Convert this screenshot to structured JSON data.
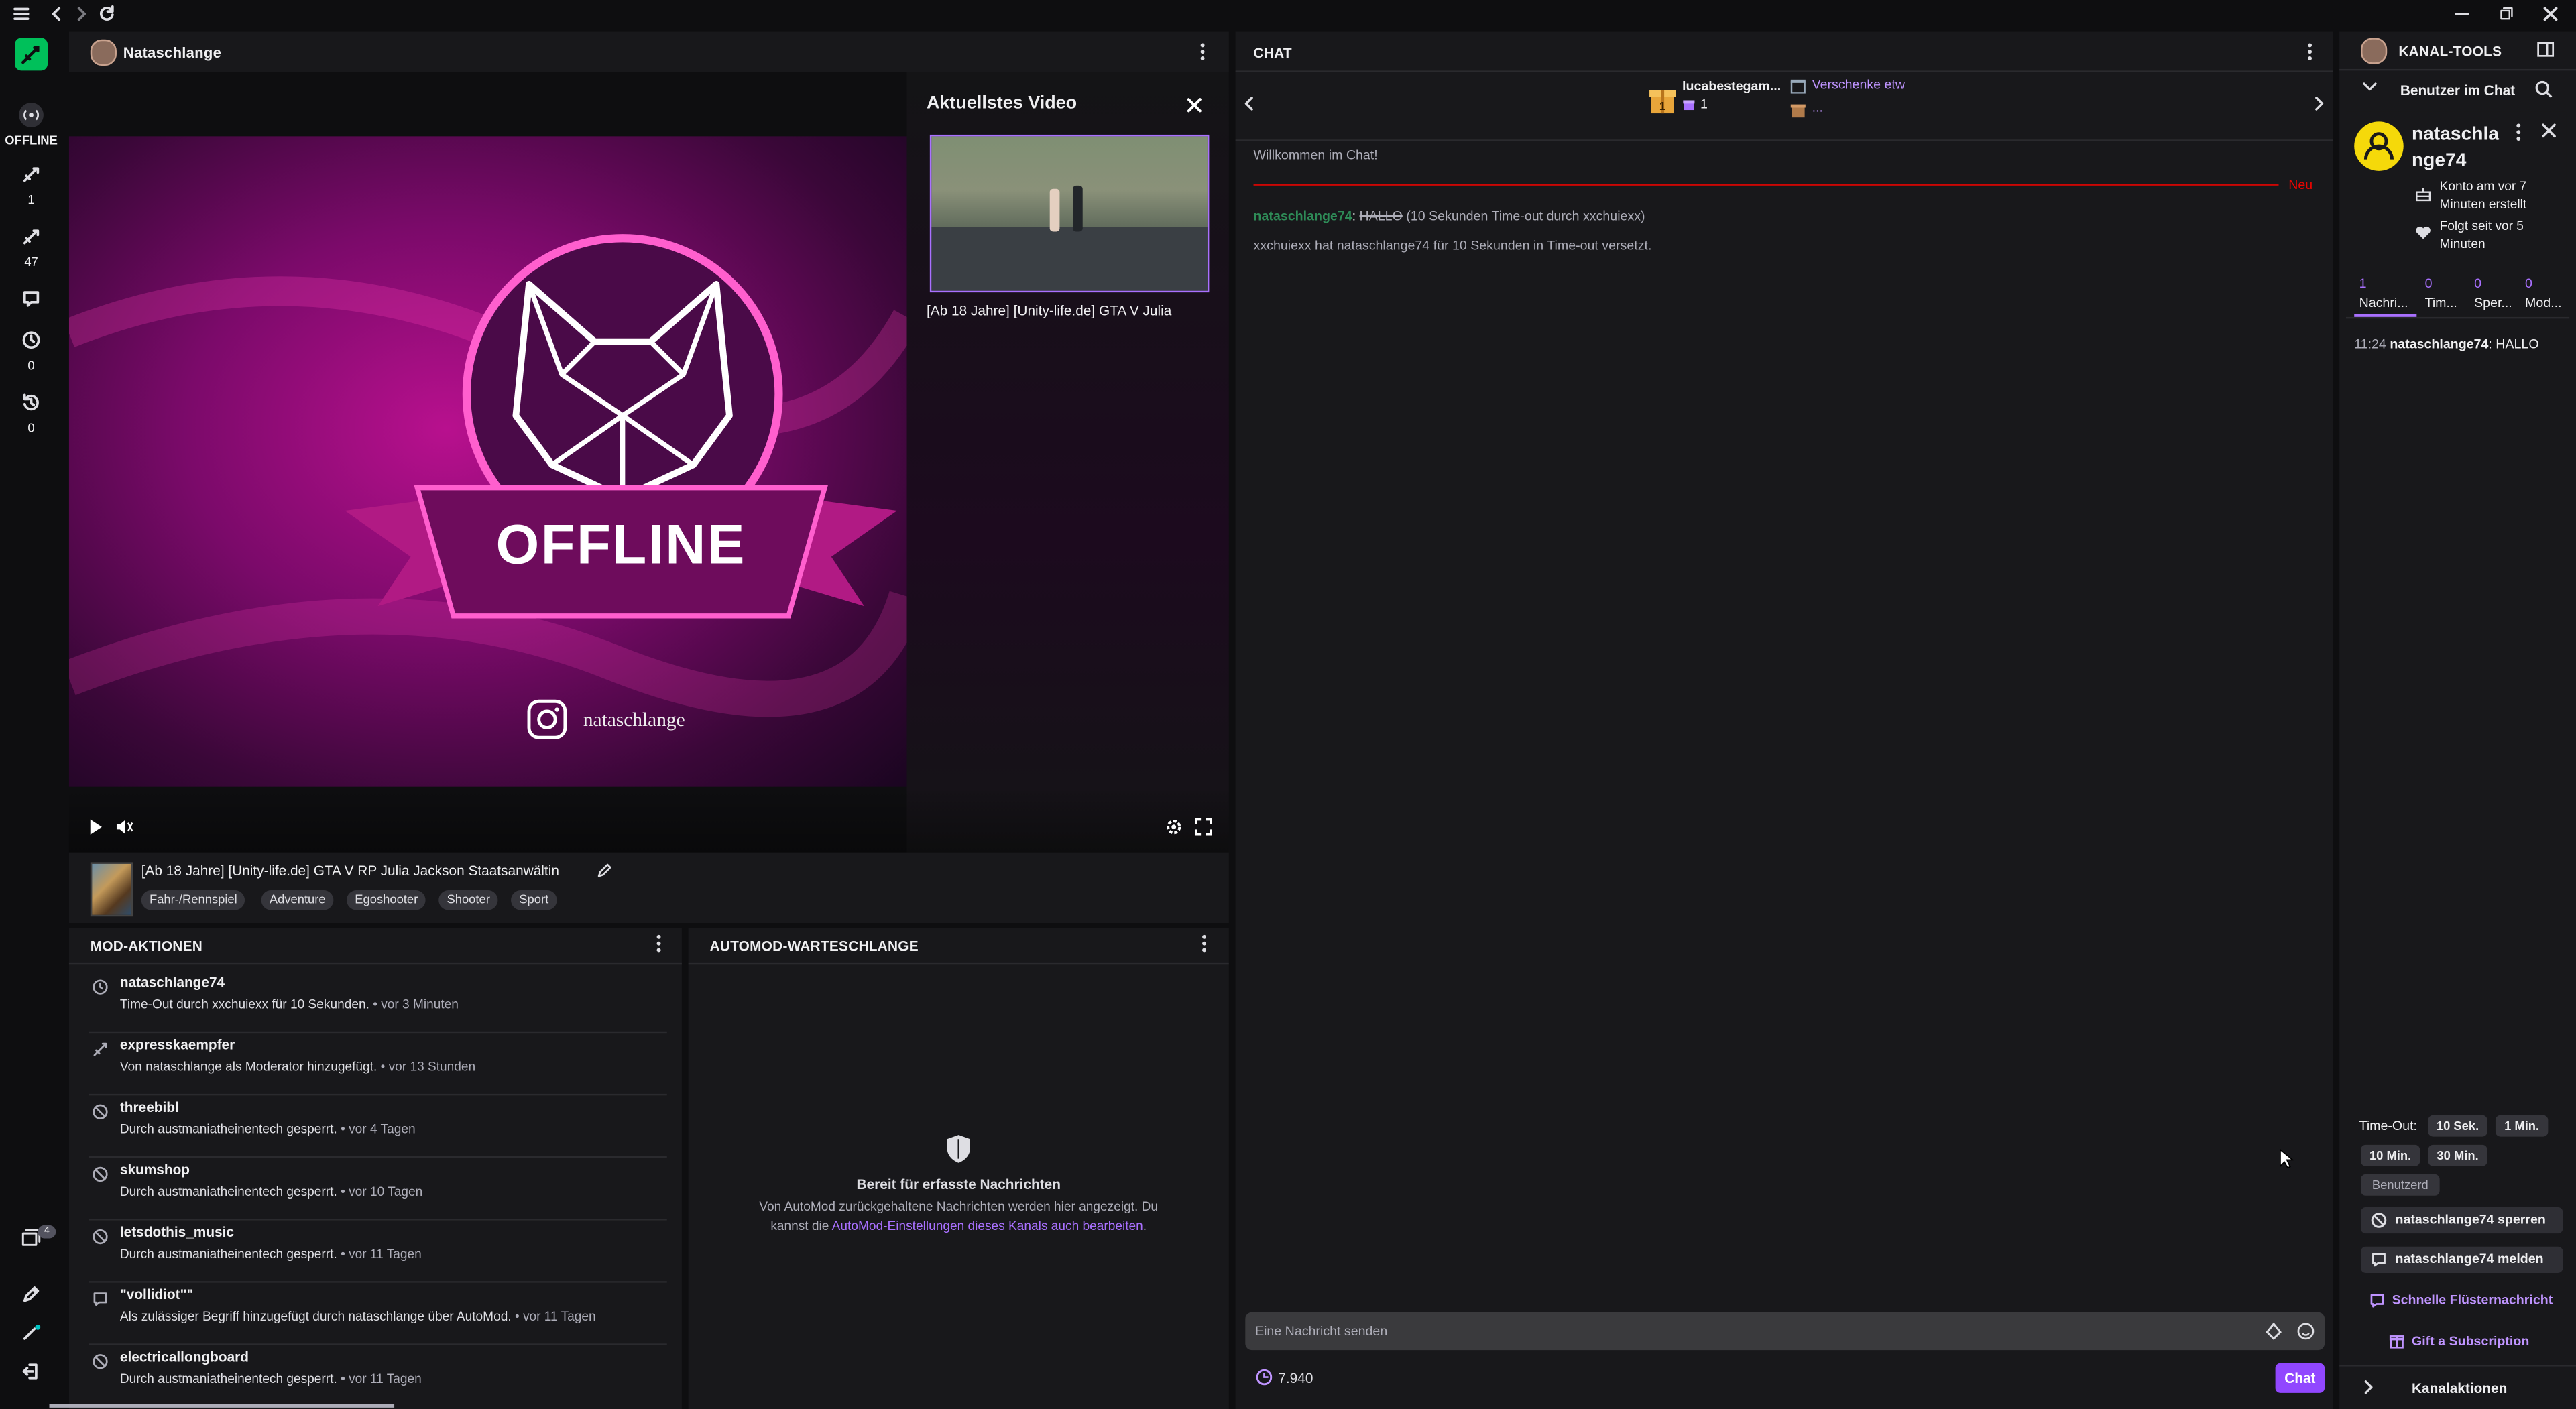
{
  "colors": {
    "accent": "#a970ff",
    "online_green": "#00c05a",
    "new_line": "#eb0400",
    "bg": "#0e0e10",
    "panel": "#18181b"
  },
  "channel": {
    "name": "Nataschlange"
  },
  "left_rail": {
    "offline_label": "OFFLINE",
    "counters": [
      {
        "icon": "sword-icon",
        "value": "1"
      },
      {
        "icon": "mod-sword-icon",
        "value": "47"
      },
      {
        "icon": "chat-bubble-icon",
        "value": ""
      },
      {
        "icon": "clock-icon",
        "value": "0"
      },
      {
        "icon": "unban-icon",
        "value": "0"
      }
    ],
    "bottom_badge": "4"
  },
  "player": {
    "offline_banner": "OFFLINE",
    "instagram_handle": "nataschlange",
    "latest_video": {
      "heading": "Aktuellstes Video",
      "title": "[Ab 18 Jahre] [Unity-life.de] GTA V Julia"
    }
  },
  "stream_info": {
    "title": "[Ab 18 Jahre] [Unity-life.de] GTA V RP Julia Jackson Staatsanwältin",
    "tags": [
      "Fahr-/Rennspiel",
      "Adventure",
      "Egoshooter",
      "Shooter",
      "Sport"
    ]
  },
  "mod_actions": {
    "title": "MOD-AKTIONEN",
    "items": [
      {
        "icon": "clock-icon",
        "user": "nataschlange74",
        "desc": "Time-Out durch xxchuiexx für 10 Sekunden.",
        "time": " • vor 3 Minuten"
      },
      {
        "icon": "sword-icon",
        "user": "expresskaempfer",
        "desc": "Von nataschlange als Moderator hinzugefügt.",
        "time": " • vor 13 Stunden"
      },
      {
        "icon": "ban-icon",
        "user": "threebibl",
        "desc": "Durch austmaniatheinentech gesperrt.",
        "time": " • vor 4 Tagen"
      },
      {
        "icon": "ban-icon",
        "user": "skumshop",
        "desc": "Durch austmaniatheinentech gesperrt.",
        "time": " • vor 10 Tagen"
      },
      {
        "icon": "ban-icon",
        "user": "letsdothis_music",
        "desc": "Durch austmaniatheinentech gesperrt.",
        "time": " • vor 11 Tagen"
      },
      {
        "icon": "term-icon",
        "user": "\"vollidiot\"\"",
        "desc": "Als zulässiger Begriff hinzugefügt durch nataschlange über AutoMod.",
        "time": " • vor 11 Tagen"
      },
      {
        "icon": "ban-icon",
        "user": "electricallongboard",
        "desc": "Durch austmaniatheinentech gesperrt.",
        "time": " • vor 11 Tagen"
      }
    ]
  },
  "automod": {
    "title": "AUTOMOD-WARTESCHLANGE",
    "heading": "Bereit für erfasste Nachrichten",
    "line1": "Von AutoMod zurückgehaltene Nachrichten werden hier angezeigt. Du",
    "line2_prefix": "kannst die ",
    "link": "AutoMod-Einstellungen dieses Kanals auch bearbeiten",
    "line2_suffix": "."
  },
  "chat": {
    "title": "CHAT",
    "gift_user": "lucabestegam...",
    "gift_count": "1",
    "gift_link": "Verschenke etw",
    "gift_more": "...",
    "welcome": "Willkommen im Chat!",
    "new_label": "Neu",
    "msg_user": "nataschlange74",
    "msg_text": "HALLO",
    "msg_note": "(10 Sekunden Time-out durch xxchuiexx)",
    "system_msg": "xxchuiexx hat nataschlange74 für 10 Sekunden in Time-out versetzt.",
    "input_placeholder": "Eine Nachricht senden",
    "points": "7.940",
    "send_label": "Chat"
  },
  "tools": {
    "title": "KANAL-TOOLS",
    "users_in_chat": "Benutzer im Chat",
    "user_name_line1": "nataschla",
    "user_name_line2": "nge74",
    "account_created": "Konto am vor 7 Minuten erstellt",
    "follows_since": "Folgt seit vor 5 Minuten",
    "stats": [
      {
        "value": "1",
        "label": "Nachri..."
      },
      {
        "value": "0",
        "label": "Tim..."
      },
      {
        "value": "0",
        "label": "Sper..."
      },
      {
        "value": "0",
        "label": "Mod..."
      }
    ],
    "log_time": "11:24",
    "log_user": "nataschlange74",
    "log_text": ": HALLO",
    "timeout_label": "Time-Out:",
    "timeout_options": [
      "10 Sek.",
      "1 Min.",
      "10 Min.",
      "30 Min."
    ],
    "custom_label": "Benutzerd",
    "ban_button": "nataschlange74 sperren",
    "report_button": "nataschlange74 melden",
    "whisper_link": "Schnelle Flüsternachricht",
    "gift_sub_link": "Gift a Subscription",
    "channel_actions": "Kanalaktionen"
  }
}
